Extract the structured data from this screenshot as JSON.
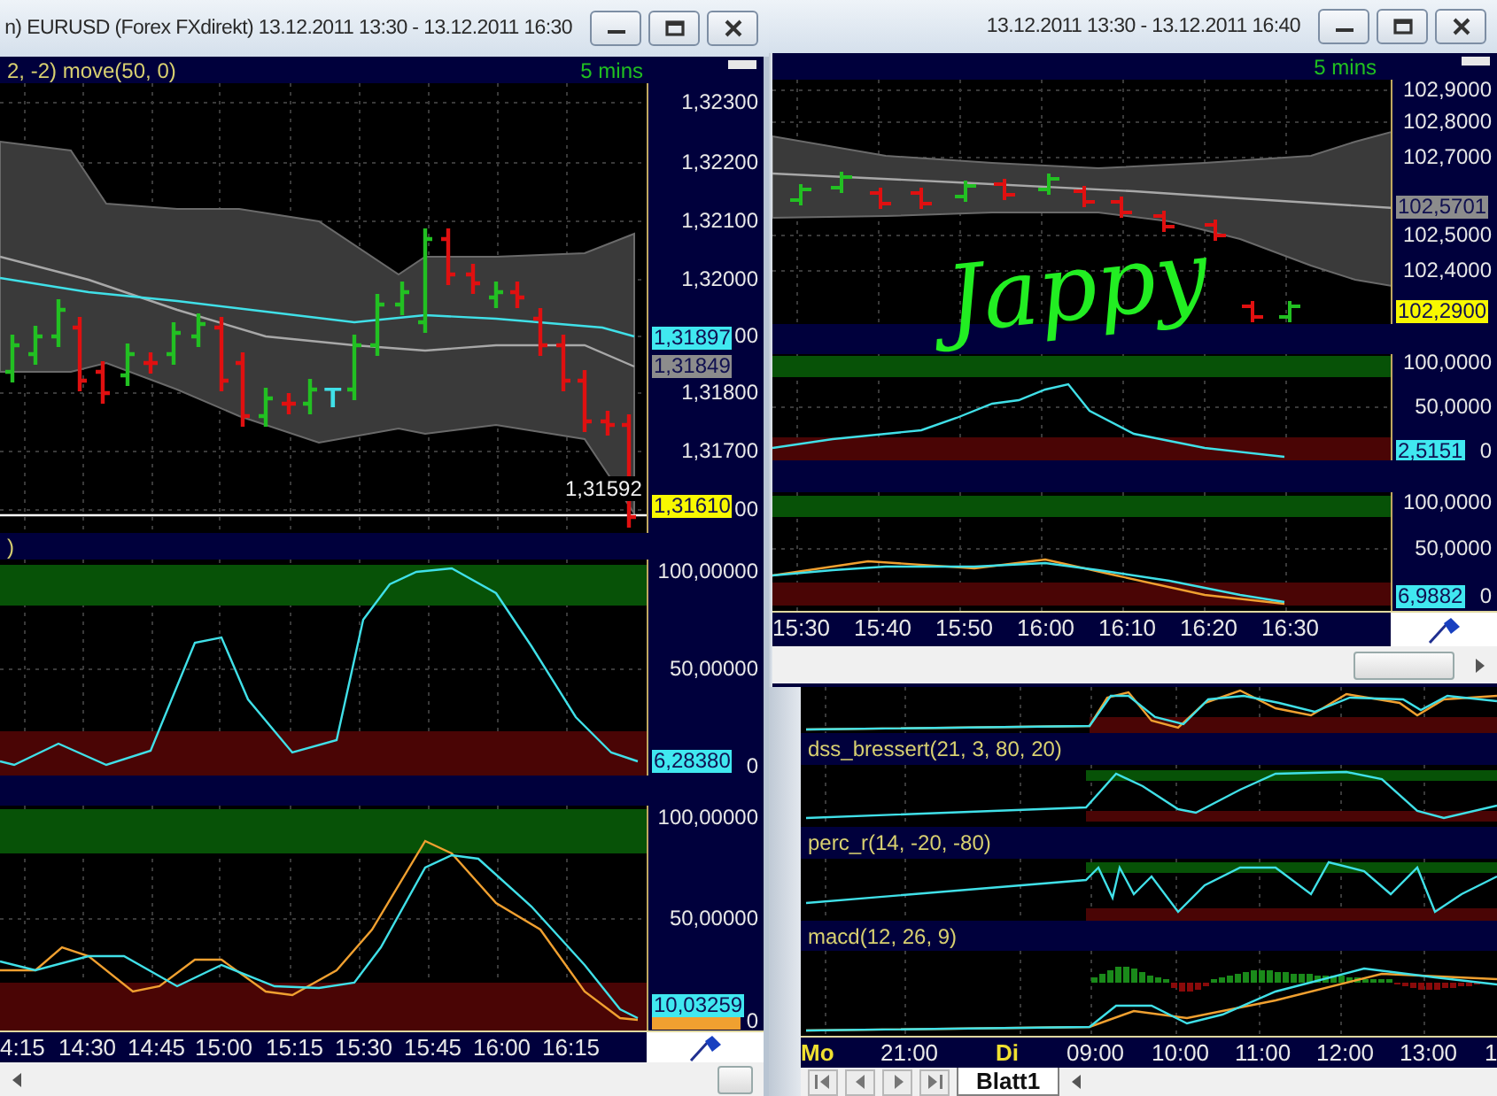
{
  "windows": [
    {
      "title": "n)  EURUSD (Forex FXdirekt) 13.12.2011 13:30 - 13.12.2011 16:30",
      "panes": [
        {
          "kind": "price",
          "header": "2, -2) move(50, 0)",
          "timeframe": "5 mins",
          "ticks": [
            "1,32300",
            "1,32200",
            "1,32100",
            "1,32000",
            "00",
            "1,31800",
            "1,31700",
            "00"
          ],
          "badges": [
            {
              "text": "1,31897",
              "color": "#40e8f0"
            },
            {
              "text": "1,31849",
              "color": "#8c8c8c"
            },
            {
              "text": "1,31610",
              "color": "#f8f800"
            }
          ],
          "last_price": "1,31592",
          "signal_mark": "T"
        },
        {
          "kind": "oscillator",
          "header": ")",
          "ticks": [
            "100,00000",
            "50,00000",
            "0"
          ],
          "badges": [
            {
              "text": "6,28380",
              "color": "#40e8f0"
            }
          ]
        },
        {
          "kind": "double_oscillator",
          "ticks": [
            "100,00000",
            "50,00000",
            "0"
          ],
          "badges": [
            {
              "text": "10,03259",
              "color": "#40e8f0"
            }
          ]
        }
      ],
      "time_labels": [
        {
          "text": "4:15",
          "kind": "time"
        },
        {
          "text": "14:30",
          "kind": "time"
        },
        {
          "text": "14:45",
          "kind": "time"
        },
        {
          "text": "15:00",
          "kind": "time"
        },
        {
          "text": "15:15",
          "kind": "time"
        },
        {
          "text": "15:30",
          "kind": "time"
        },
        {
          "text": "15:45",
          "kind": "time"
        },
        {
          "text": "16:00",
          "kind": "time"
        },
        {
          "text": "16:15",
          "kind": "time"
        }
      ]
    },
    {
      "title": "13.12.2011 13:30 - 13.12.2011 16:40",
      "panes": [
        {
          "kind": "price",
          "timeframe": "5 mins",
          "ticks": [
            "102,9000",
            "102,8000",
            "102,7000",
            "102,5000",
            "102,4000"
          ],
          "badges": [
            {
              "text": "102,5701",
              "color": "#8c8c8c"
            },
            {
              "text": "102,2900",
              "color": "#f8f800"
            }
          ],
          "annotation": "Jappy"
        },
        {
          "kind": "oscillator",
          "ticks": [
            "100,0000",
            "50,0000",
            "0"
          ],
          "badges": [
            {
              "text": "2,5151",
              "color": "#40e8f0"
            }
          ]
        },
        {
          "kind": "double_oscillator",
          "ticks": [
            "100,0000",
            "50,0000",
            "0"
          ],
          "badges": [
            {
              "text": "6,9882",
              "color": "#40e8f0"
            }
          ]
        }
      ],
      "time_labels": [
        {
          "text": "15:30",
          "kind": "time"
        },
        {
          "text": "15:40",
          "kind": "time"
        },
        {
          "text": "15:50",
          "kind": "time"
        },
        {
          "text": "16:00",
          "kind": "time"
        },
        {
          "text": "16:10",
          "kind": "time"
        },
        {
          "text": "16:20",
          "kind": "time"
        },
        {
          "text": "16:30",
          "kind": "time"
        }
      ]
    },
    {
      "panes": [
        {
          "kind": "double_oscillator"
        },
        {
          "kind": "oscillator",
          "header": "dss_bressert(21, 3, 80, 20)"
        },
        {
          "kind": "oscillator",
          "header": "perc_r(14, -20, -80)"
        },
        {
          "kind": "macd",
          "header": "macd(12, 26, 9)"
        }
      ],
      "time_labels": [
        {
          "text": "Mo",
          "kind": "day"
        },
        {
          "text": "21:00",
          "kind": "time"
        },
        {
          "text": "Di",
          "kind": "day"
        },
        {
          "text": "09:00",
          "kind": "time"
        },
        {
          "text": "10:00",
          "kind": "time"
        },
        {
          "text": "11:00",
          "kind": "time"
        },
        {
          "text": "12:00",
          "kind": "time"
        },
        {
          "text": "13:00",
          "kind": "time"
        },
        {
          "text": "1",
          "kind": "time"
        }
      ],
      "sheet_tabs": [
        {
          "label": "Blatt1",
          "selected": true
        }
      ]
    }
  ]
}
